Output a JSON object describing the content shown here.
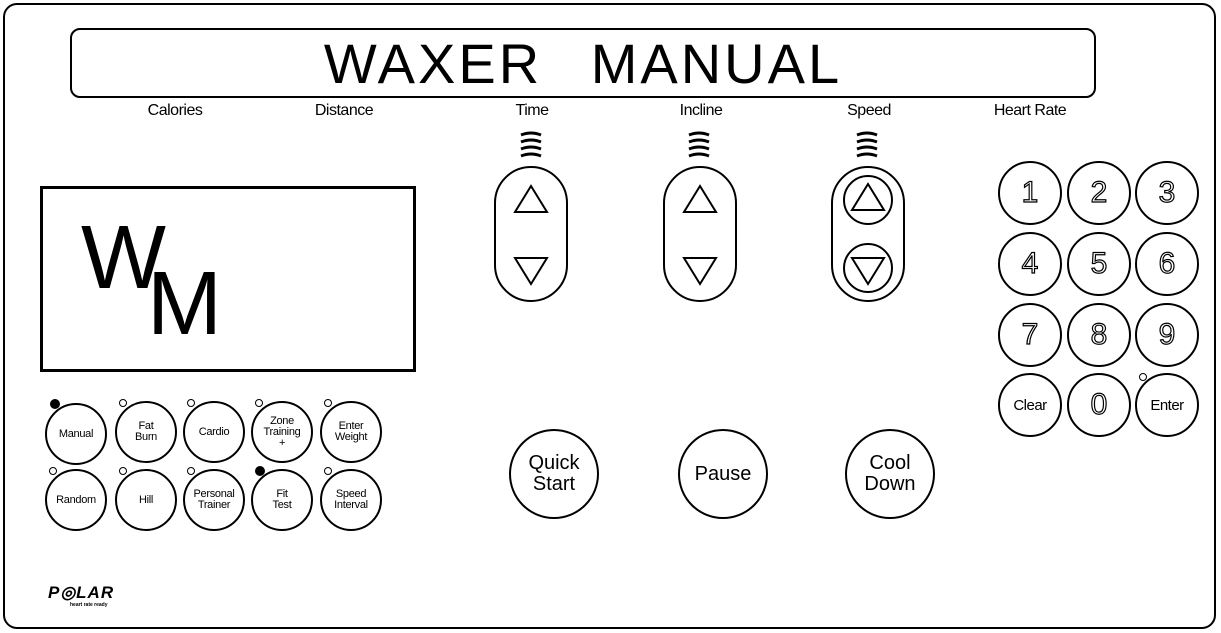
{
  "header": {
    "title": "WAXER MANUAL"
  },
  "display_labels": {
    "calories": "Calories",
    "distance": "Distance",
    "time": "Time",
    "incline": "Incline",
    "speed": "Speed",
    "heart_rate": "Heart Rate"
  },
  "logo": {
    "letter_w": "W",
    "letter_m": "M"
  },
  "programs": {
    "row1": [
      {
        "label": "Manual",
        "led": "on"
      },
      {
        "label": "Fat\nBurn",
        "led": "off"
      },
      {
        "label": "Cardio",
        "led": "off"
      },
      {
        "label": "Zone\nTraining\n+",
        "led": "off"
      },
      {
        "label": "Enter\nWeight",
        "led": "off"
      }
    ],
    "row2": [
      {
        "label": "Random",
        "led": "off"
      },
      {
        "label": "Hill",
        "led": "off"
      },
      {
        "label": "Personal\nTrainer",
        "led": "off"
      },
      {
        "label": "Fit\nTest",
        "led": "on"
      },
      {
        "label": "Speed\nInterval",
        "led": "off"
      }
    ]
  },
  "controls": {
    "quick_start": "Quick\nStart",
    "pause": "Pause",
    "cool_down": "Cool\nDown"
  },
  "keypad": {
    "keys": [
      "1",
      "2",
      "3",
      "4",
      "5",
      "6",
      "7",
      "8",
      "9",
      "Clear",
      "0",
      "Enter"
    ]
  },
  "brand": {
    "name": "P◎LAR",
    "tagline": "heart rate ready"
  },
  "icons": {
    "up": "up-arrow-icon",
    "down": "down-arrow-icon",
    "bars": "level-bars-icon"
  }
}
